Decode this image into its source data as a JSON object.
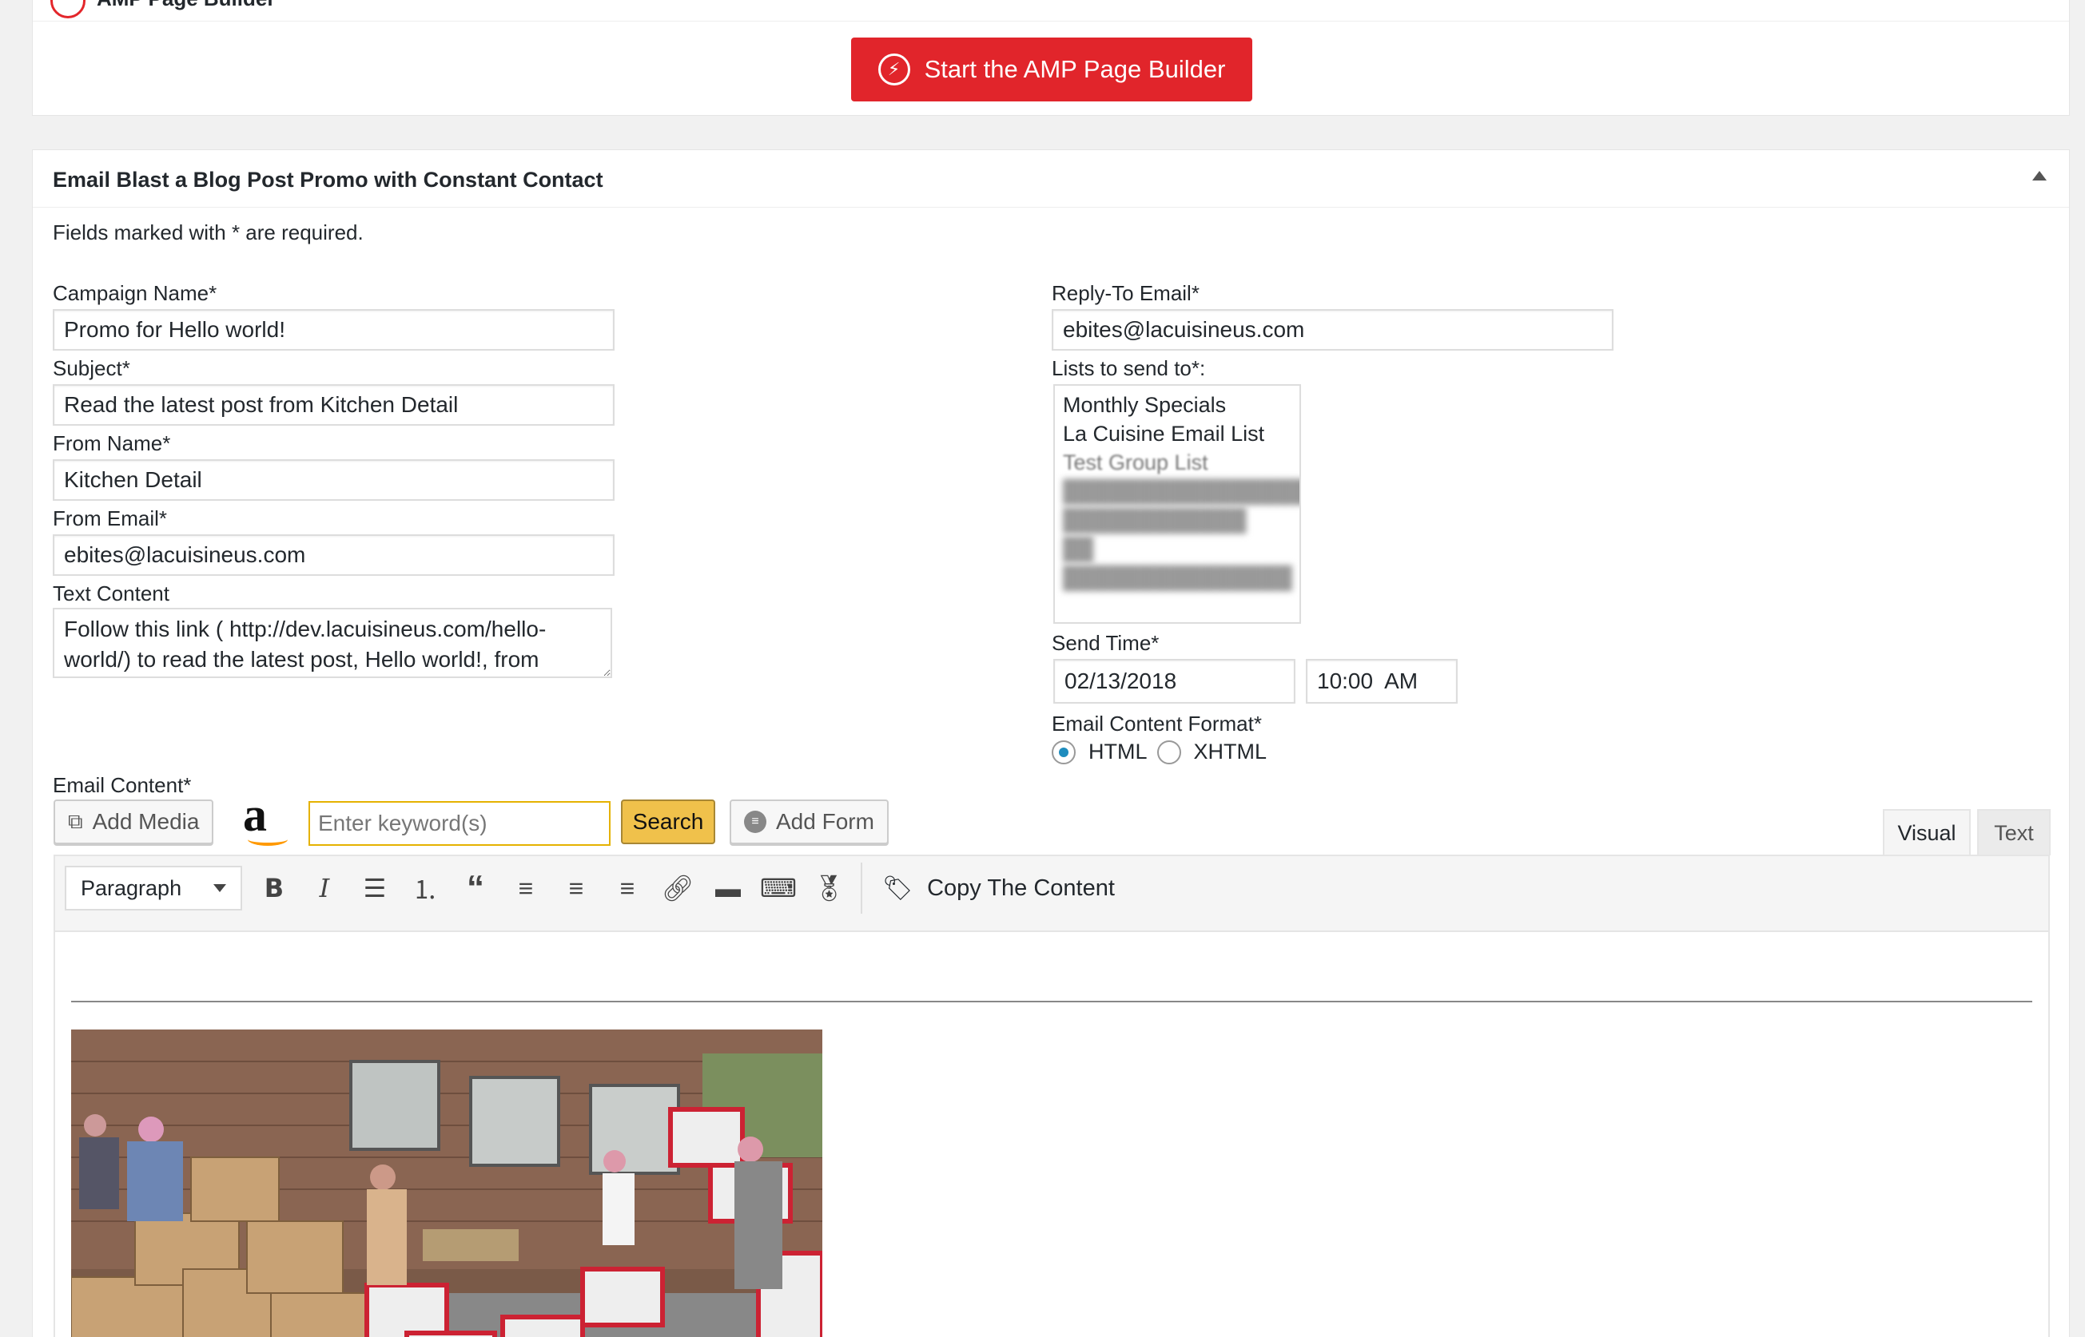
{
  "amp": {
    "section_title": "AMP Page Builder",
    "start_button_label": "Start the AMP Page Builder"
  },
  "panel": {
    "title": "Email Blast a Blog Post Promo with Constant Contact",
    "required_note": "Fields marked with * are required."
  },
  "form": {
    "campaign_name": {
      "label": "Campaign Name*",
      "value": "Promo for Hello world!"
    },
    "subject": {
      "label": "Subject*",
      "value": "Read the latest post from Kitchen Detail"
    },
    "from_name": {
      "label": "From Name*",
      "value": "Kitchen Detail"
    },
    "from_email": {
      "label": "From Email*",
      "value": "ebites@lacuisineus.com"
    },
    "text_content": {
      "label": "Text Content",
      "line1": "Follow this link ( http://dev.lacuisineus.com/hello-",
      "line2": "world/) to read the latest post, Hello world!, from"
    },
    "reply_to": {
      "label": "Reply-To Email*",
      "value": "ebites@lacuisineus.com"
    },
    "lists": {
      "label": "Lists to send to*:",
      "items": [
        "Monthly Specials",
        "La Cuisine Email List",
        "Test Group List"
      ]
    },
    "send_time": {
      "label": "Send Time*",
      "date": "02/13/2018",
      "time": "10:00  AM"
    },
    "format": {
      "label": "Email Content Format*",
      "option_html": "HTML",
      "option_xhtml": "XHTML",
      "selected": "HTML"
    }
  },
  "editor": {
    "label": "Email Content*",
    "add_media": "Add Media",
    "keyword_placeholder": "Enter keyword(s)",
    "search": "Search",
    "add_form": "Add Form",
    "tab_visual": "Visual",
    "tab_text": "Text",
    "format_select": "Paragraph",
    "copy_content": "Copy The Content"
  },
  "colors": {
    "amp_red": "#e1252b",
    "radio_blue": "#1e8cbe",
    "amazon_yellow": "#f0c14b"
  }
}
